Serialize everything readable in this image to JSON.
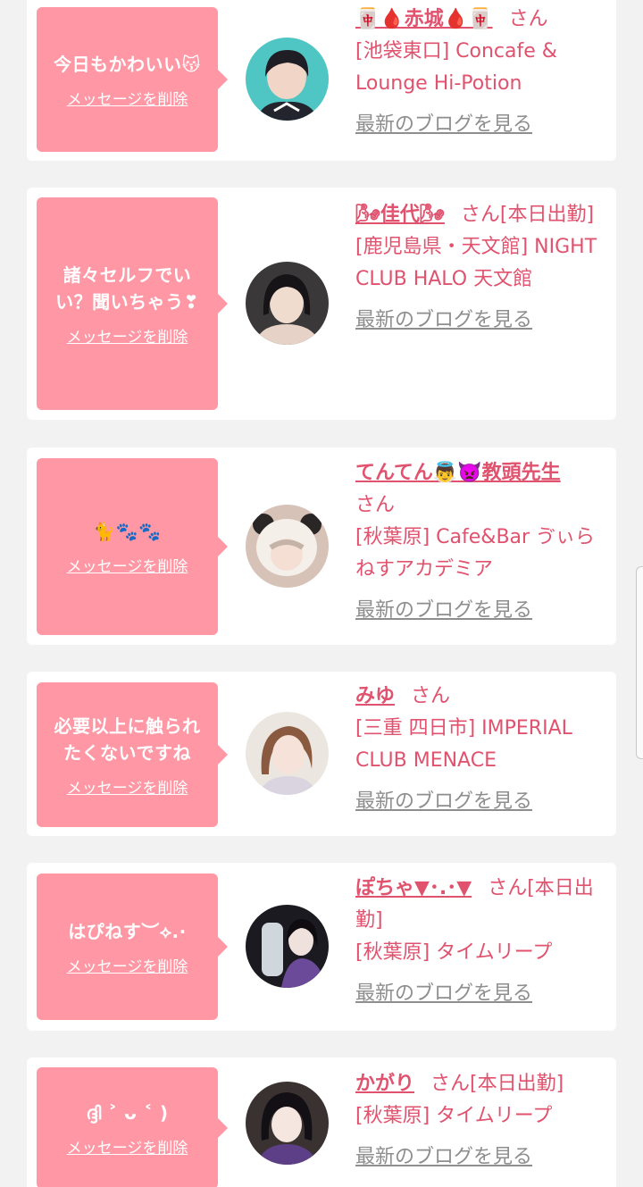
{
  "delete_label": "メッセージを削除",
  "blog_label": "最新のブログを見る",
  "cards": [
    {
      "message": "今日もかわいい😽",
      "name": "🀄🩸赤城🩸🀄",
      "san": "さん",
      "shop": "[池袋東口] Concafe & Lounge Hi-Potion"
    },
    {
      "message": "諸々セルフでいい？聞いちゃう❣",
      "name": "🌬佳代🌬",
      "san": "さん[本日出勤]",
      "shop": "[鹿児島県・天文館] NIGHT CLUB HALO 天文館"
    },
    {
      "message": "🐈🐾🐾",
      "name": "てんてん👼👿教頭先生",
      "san": "さん",
      "shop": "[秋葉原] Cafe&Bar ゔぃらねすアカデミア"
    },
    {
      "message": "必要以上に触られたくないですね",
      "name": "みゆ",
      "san": "さん",
      "shop": "[三重 四日市] IMPERIAL CLUB MENACE"
    },
    {
      "message": "はぴねす︶⟡.·",
      "name": "ぽちゃ▼･.･▼",
      "san": "さん[本日出勤]",
      "shop": "[秋葉原] タイムリープ"
    },
    {
      "message": "ദ്ദി ˃ ᴗ ˂ )",
      "name": "かがり",
      "san": "さん[本日出勤]",
      "shop": "[秋葉原] タイムリープ"
    }
  ]
}
